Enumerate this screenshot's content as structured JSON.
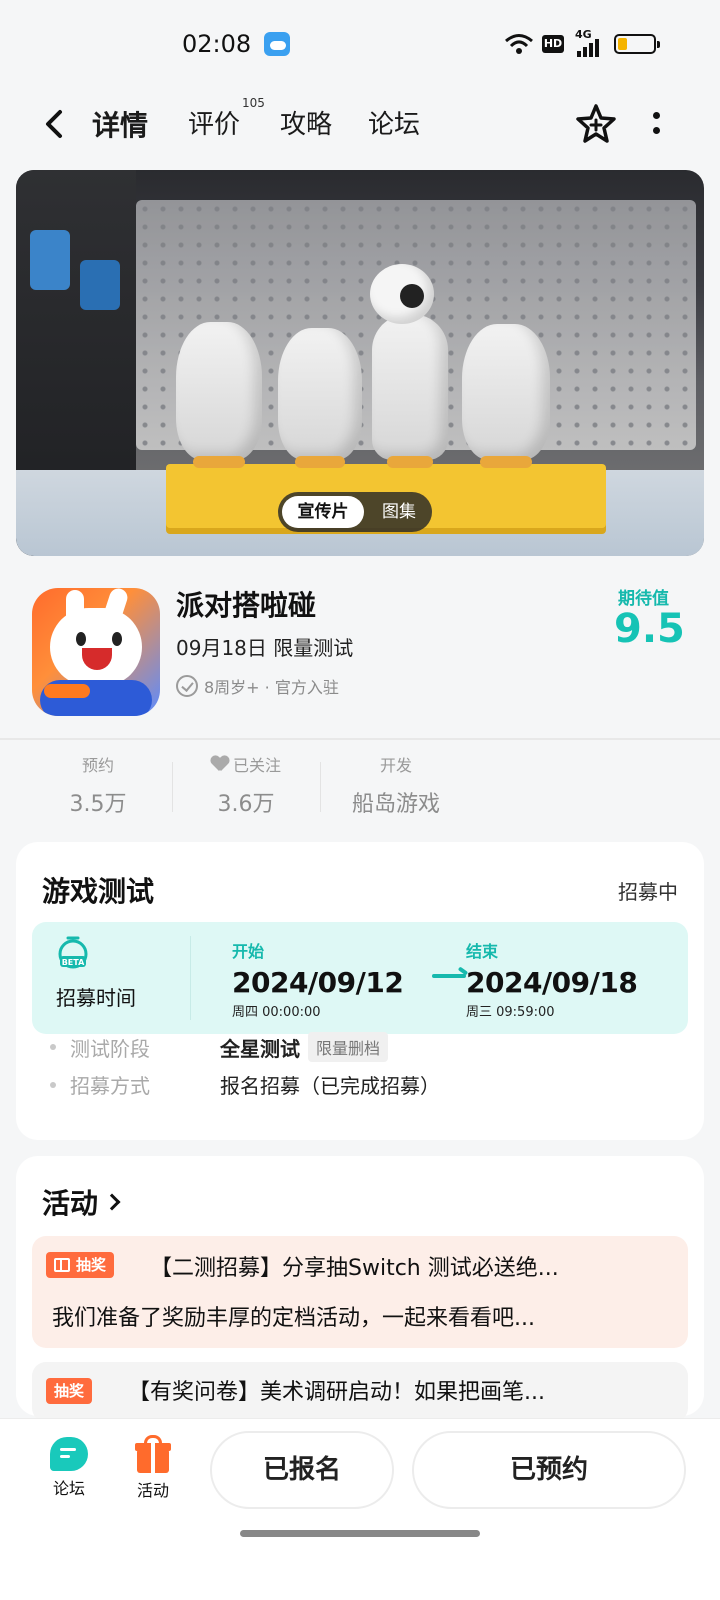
{
  "status_bar": {
    "time": "02:08",
    "hd": "HD",
    "network": "4G"
  },
  "nav": {
    "tabs": [
      {
        "label": "详情",
        "active": true
      },
      {
        "label": "评价",
        "badge": "105"
      },
      {
        "label": "攻略"
      },
      {
        "label": "论坛"
      }
    ]
  },
  "hero": {
    "toggle": {
      "video": "宣传片",
      "gallery": "图集"
    }
  },
  "game": {
    "title": "派对搭啦碰",
    "date_line": "09月18日  限量测试",
    "meta": "8周岁+ · 官方入驻",
    "expect_label": "期待值",
    "expect_value": "9.5"
  },
  "stats": [
    {
      "label": "预约",
      "value": "3.5万"
    },
    {
      "label": "已关注",
      "value": "3.6万"
    },
    {
      "label": "开发",
      "value": "船岛游戏"
    }
  ],
  "test_card": {
    "title": "游戏测试",
    "status": "招募中",
    "recruit_label": "招募时间",
    "start": {
      "label": "开始",
      "date": "2024/09/12",
      "sub": "周四  00:00:00"
    },
    "end": {
      "label": "结束",
      "date": "2024/09/18",
      "sub": "周三  09:59:00"
    },
    "details": [
      {
        "key": "测试阶段",
        "value": "全星测试",
        "tag": "限量删档"
      },
      {
        "key": "招募方式",
        "value": "报名招募（已完成招募）"
      }
    ]
  },
  "activity_card": {
    "title": "活动",
    "items": [
      {
        "tag": "抽奖",
        "line1": "【二测招募】分享抽Switch 测试必送绝...",
        "line2": "我们准备了奖励丰厚的定档活动，一起来看看吧..."
      },
      {
        "tag": "抽奖",
        "line1": "【有奖问卷】美术调研启动！如果把画笔..."
      }
    ]
  },
  "bottom_bar": {
    "forum": "论坛",
    "activity": "活动",
    "signup_btn": "已报名",
    "reserve_btn": "已预约"
  },
  "colors": {
    "accent": "#16c3b5",
    "orange": "#ff6b2c"
  }
}
